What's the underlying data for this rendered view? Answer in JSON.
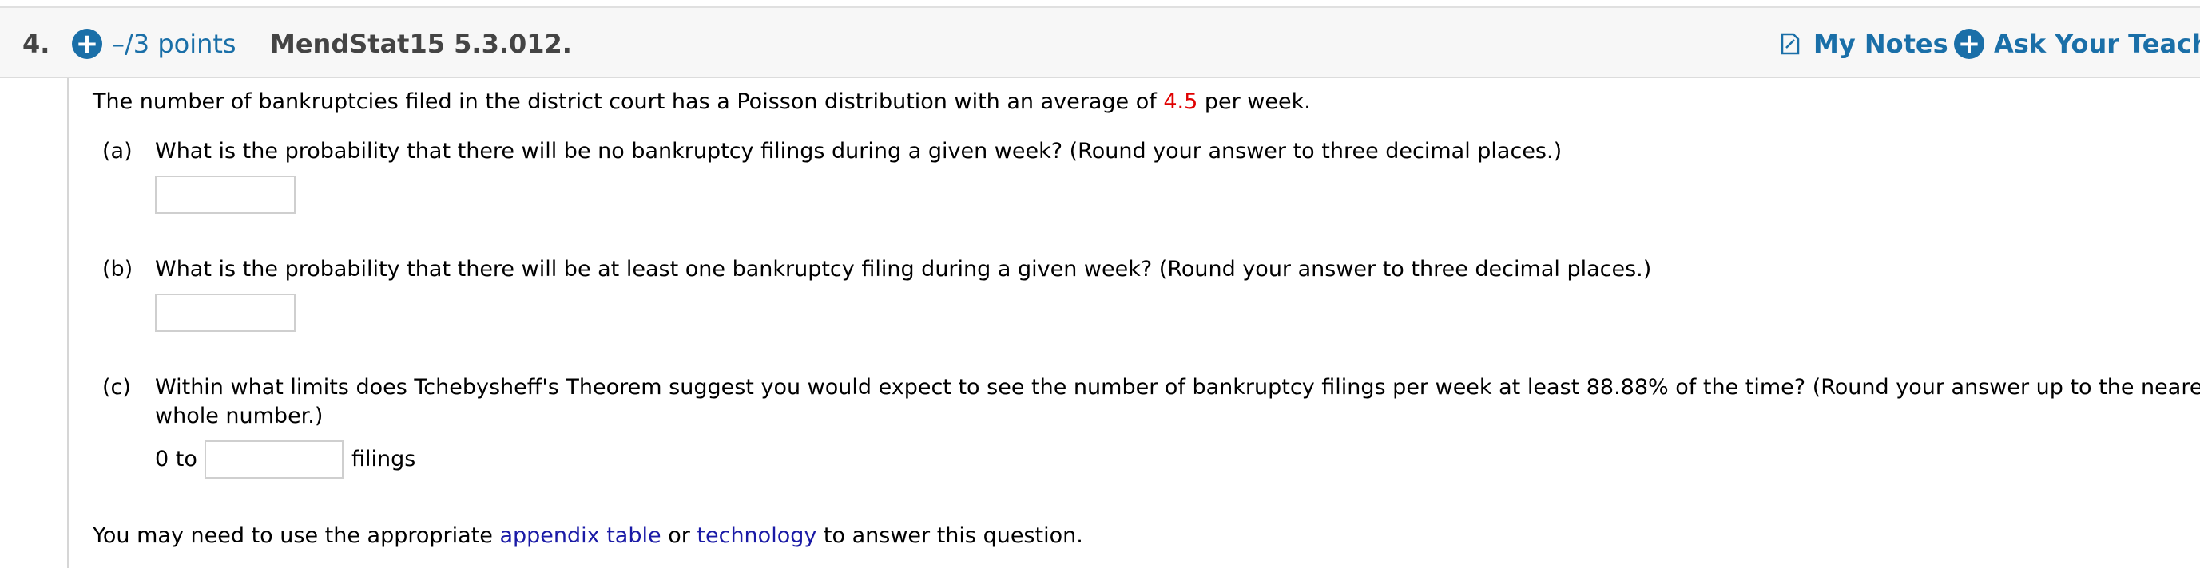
{
  "header": {
    "question_number": "4.",
    "points": "–/3 points",
    "question_id": "MendStat15 5.3.012.",
    "my_notes": "My Notes",
    "ask_teacher": "Ask Your Teacher"
  },
  "problem": {
    "intro_before": "The number of bankruptcies filed in the district court has a Poisson distribution with an average of ",
    "intro_value": "4.5",
    "intro_after": " per week."
  },
  "parts": [
    {
      "label": "(a)",
      "question": "What is the probability that there will be no bankruptcy filings during a given week? (Round your answer to three decimal places.)",
      "answer_value": ""
    },
    {
      "label": "(b)",
      "question": "What is the probability that there will be at least one bankruptcy filing during a given week? (Round your answer to three decimal places.)",
      "answer_value": ""
    },
    {
      "label": "(c)",
      "question_line1": "Within what limits does Tchebysheff's Theorem suggest you would expect to see the number of bankruptcy filings per week at least 88.88% of the time? (Round your answer up to the nearest",
      "question_line2": "whole number.)",
      "range_prefix": "0 to",
      "range_suffix": "filings",
      "answer_value": ""
    }
  ],
  "footer": {
    "before": "You may need to use the appropriate ",
    "link1": "appendix table",
    "middle": " or ",
    "link2": "technology",
    "after": " to answer this question."
  },
  "colors": {
    "accent": "#1a6fa8",
    "highlight": "#e00000",
    "link": "#1a1aa6"
  },
  "icons": {
    "points": "plus-circle-icon",
    "notes": "notes-icon",
    "ask": "plus-circle-icon"
  }
}
